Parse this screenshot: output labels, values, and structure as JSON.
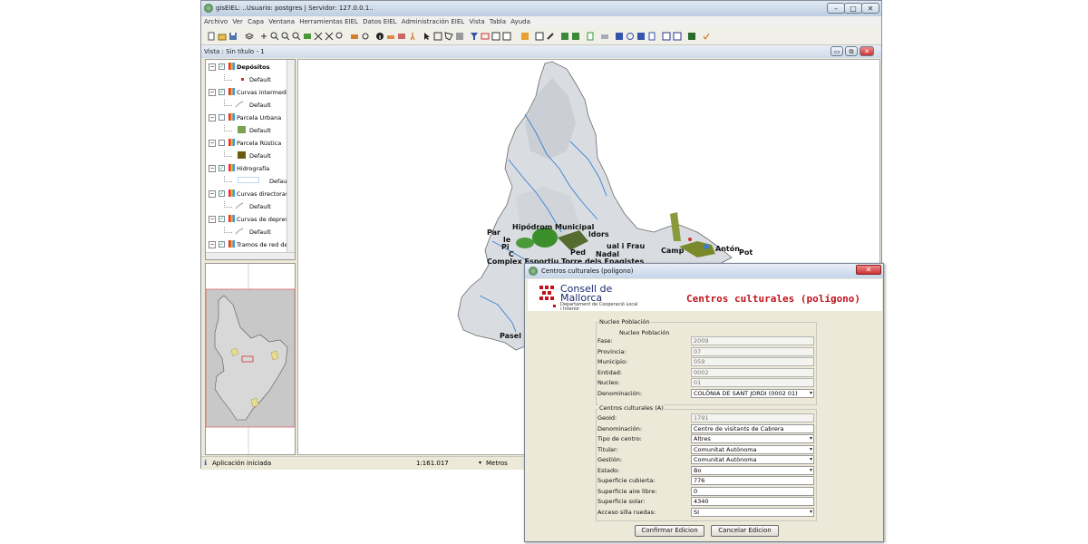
{
  "window": {
    "title": "gisEIEL: ..Usuario: postgres | Servidor: 127.0.0.1..",
    "controls": [
      "–",
      "□",
      "✕"
    ]
  },
  "menubar": [
    "Archivo",
    "Ver",
    "Capa",
    "Ventana",
    "Herramientas EIEL",
    "Datos EIEL",
    "Administración EIEL",
    "Vista",
    "Tabla",
    "Ayuda"
  ],
  "view": {
    "title": "Vista : Sin título - 1"
  },
  "toc": {
    "layers": [
      {
        "name": "Depósitos",
        "checked": true,
        "legend": "Default",
        "swatch": "#cc3333",
        "swatch_kind": "point"
      },
      {
        "name": "Curvas intermedias",
        "checked": true,
        "legend": "Default",
        "swatch": "#88aa88",
        "swatch_kind": "line"
      },
      {
        "name": "Parcela Urbana",
        "checked": false,
        "legend": "Default",
        "swatch": "#7aa050",
        "swatch_kind": "fill"
      },
      {
        "name": "Parcela Rústica",
        "checked": false,
        "legend": "Default",
        "swatch": "#6b5a10",
        "swatch_kind": "fill"
      },
      {
        "name": "Hidrografía",
        "checked": true,
        "legend": "Defaul",
        "swatch": "#bcd6f0",
        "swatch_kind": "outline"
      },
      {
        "name": "Curvas directoras",
        "checked": true,
        "legend": "Default",
        "swatch": "#88aa88",
        "swatch_kind": "line"
      },
      {
        "name": "Curvas de depresión",
        "checked": true,
        "legend": "Default",
        "swatch": "#88aa88",
        "swatch_kind": "line"
      },
      {
        "name": "Tramos de red de di",
        "checked": true,
        "legend": "",
        "swatch": "",
        "swatch_kind": "none"
      }
    ]
  },
  "map_labels": [
    "Hipódrom Municipal",
    "Par",
    "le",
    "Pi",
    "C",
    "ldors",
    "ual i Frau",
    "Ped",
    "Nadal",
    "Complex Esportiu Torre dels Enagistes",
    "Camp",
    "Antón",
    "Pot",
    "Pasel"
  ],
  "statusbar": {
    "message": "Aplicación iniciada",
    "scale": "1:161.017",
    "units": "Metros"
  },
  "dialog": {
    "title": "Centros culturales (polígono)",
    "logo_line1": "Consell de",
    "logo_line2": "Mallorca",
    "logo_sub1": "Departament de Cooperació Local",
    "logo_sub2": "i Interior",
    "heading": "Centros culturales (polígono)",
    "section1_outer": "Nucleo Población",
    "section1_inner": "Nucleo Población",
    "section1_fields": [
      {
        "label": "Fase:",
        "value": "2009",
        "readonly": true,
        "dropdown": false
      },
      {
        "label": "Provincia:",
        "value": "07",
        "readonly": true,
        "dropdown": false
      },
      {
        "label": "Municipio:",
        "value": "059",
        "readonly": true,
        "dropdown": false
      },
      {
        "label": "Entidad:",
        "value": "0002",
        "readonly": true,
        "dropdown": false
      },
      {
        "label": "Nucleo:",
        "value": "01",
        "readonly": true,
        "dropdown": false
      },
      {
        "label": "Denominación:",
        "value": "COLÒNIA DE SANT JORDI (0002 01)",
        "readonly": false,
        "dropdown": true
      }
    ],
    "section2_title": "Centros culturales (A)",
    "section2_fields": [
      {
        "label": "GeoId:",
        "value": "1791",
        "readonly": true,
        "dropdown": false
      },
      {
        "label": "Denominación:",
        "value": "Centre de visitants de Cabrera",
        "readonly": false,
        "dropdown": false
      },
      {
        "label": "Tipo de centro:",
        "value": "Altres",
        "readonly": false,
        "dropdown": true
      },
      {
        "label": "Titular:",
        "value": "Comunitat Autònoma",
        "readonly": false,
        "dropdown": true
      },
      {
        "label": "Gestión:",
        "value": "Comunitat Autònoma",
        "readonly": false,
        "dropdown": true
      },
      {
        "label": "Estado:",
        "value": "Bo",
        "readonly": false,
        "dropdown": true
      },
      {
        "label": "Superficie cubierta:",
        "value": "776",
        "readonly": false,
        "dropdown": false
      },
      {
        "label": "Superficie aire libre:",
        "value": "0",
        "readonly": false,
        "dropdown": false
      },
      {
        "label": "Superficie solar:",
        "value": "4340",
        "readonly": false,
        "dropdown": false
      },
      {
        "label": "Acceso silla ruedas:",
        "value": "SI",
        "readonly": false,
        "dropdown": true
      }
    ],
    "confirm_label": "Confirmar Edicion",
    "cancel_label": "Cancelar Edicion",
    "close_glyph": "✕"
  },
  "colors": {
    "heading_red": "#c0141c",
    "accent_green": "#2e8b1e",
    "map_land": "#d9dde2",
    "window_bg": "#ece9d8"
  }
}
